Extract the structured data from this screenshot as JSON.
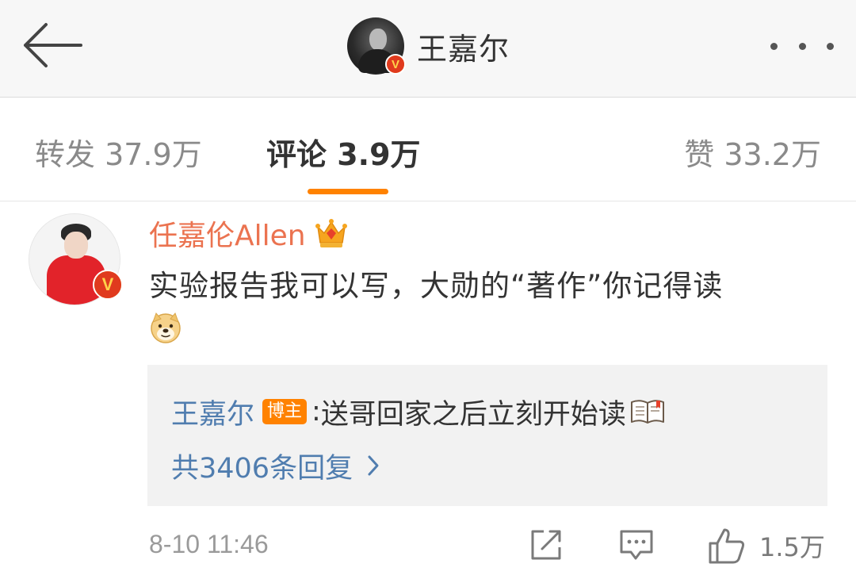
{
  "header": {
    "title": "王嘉尔",
    "back_icon": "arrow-left-icon",
    "more_icon": "more-dots-icon",
    "verified_mark": "V"
  },
  "tabs": [
    {
      "label": "转发 37.9万",
      "active": false
    },
    {
      "label": "评论 3.9万",
      "active": true
    },
    {
      "label": "赞 33.2万",
      "active": false
    }
  ],
  "comment": {
    "author": "任嘉伦Allen",
    "verified_mark": "V",
    "text": "实验报告我可以写，大勋的“著作”你记得读",
    "reply": {
      "author": "王嘉尔",
      "badge": "博主",
      "separator": ":",
      "text": "送哥回家之后立刻开始读",
      "more": "共3406条回复"
    },
    "timestamp": "8-10 11:46",
    "like_count": "1.5万"
  },
  "colors": {
    "accent_orange": "#ff8200",
    "name_orange": "#eb7350",
    "link_blue": "#507daf"
  }
}
